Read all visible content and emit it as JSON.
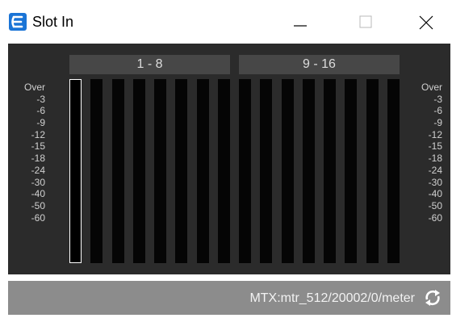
{
  "window": {
    "title": "Slot In"
  },
  "groups": [
    "1 - 8",
    "9 - 16"
  ],
  "scale_labels": [
    "Over",
    "-3",
    "-6",
    "-9",
    "-12",
    "-15",
    "-18",
    "-24",
    "-30",
    "-40",
    "-50",
    "-60"
  ],
  "meters": {
    "count": 16,
    "selected_index": 0
  },
  "status": {
    "path": "MTX:mtr_512/20002/0/meter"
  },
  "icons": {
    "app": "app-e-icon",
    "minimize": "minimize-icon",
    "maximize": "maximize-icon",
    "close": "close-icon",
    "refresh": "refresh-icon"
  },
  "colors": {
    "panel_bg": "#2b2b2b",
    "group_label_bg": "#474747",
    "status_bg": "#8c8c8c",
    "app_icon": "#1a74d6"
  }
}
